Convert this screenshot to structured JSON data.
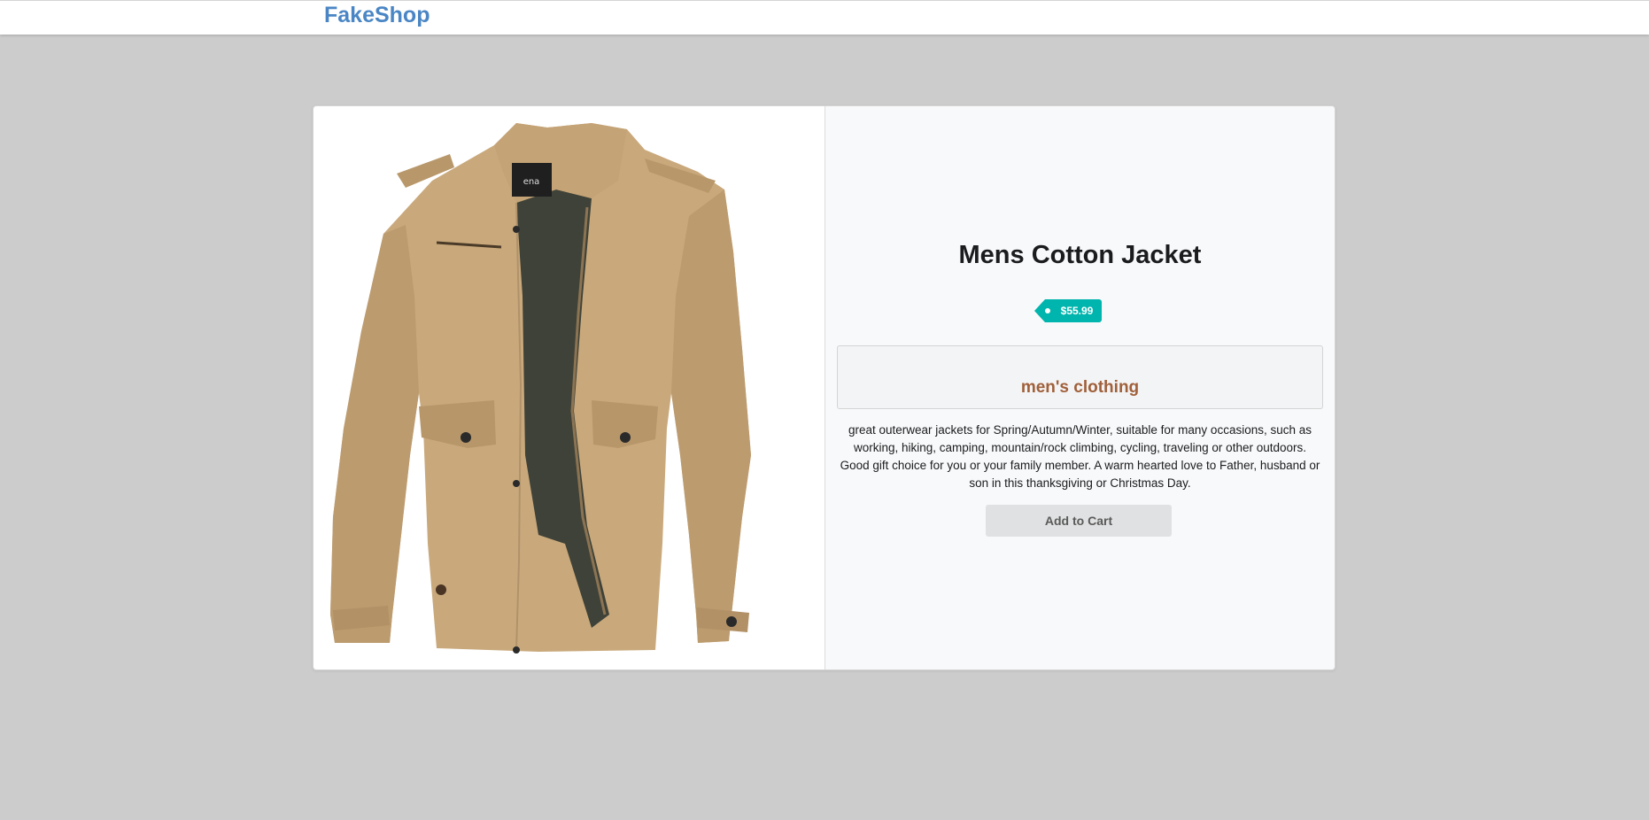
{
  "header": {
    "brand": "FakeShop"
  },
  "product": {
    "title": "Mens Cotton Jacket",
    "price": "$55.99",
    "category": "men's clothing",
    "description": "great outerwear jackets for Spring/Autumn/Winter, suitable for many occasions, such as working, hiking, camping, mountain/rock climbing, cycling, traveling or other outdoors. Good gift choice for you or your family member. A warm hearted love to Father, husband or son in this thanksgiving or Christmas Day.",
    "add_to_cart_label": "Add to Cart",
    "image_alt": "Mens Cotton Jacket"
  },
  "colors": {
    "brand": "#4a86c5",
    "price_tag": "#00b5ad",
    "category": "#a0603a",
    "background": "#cccccc"
  }
}
